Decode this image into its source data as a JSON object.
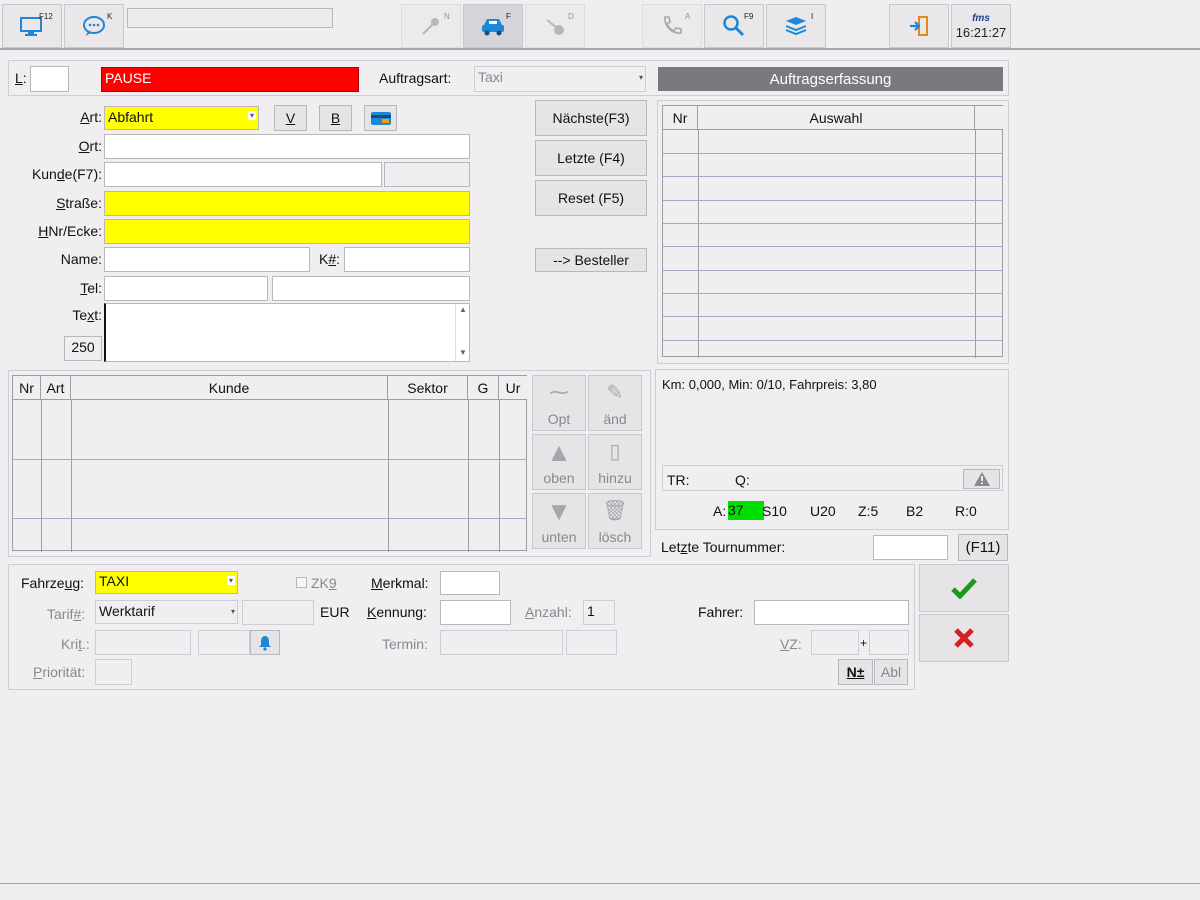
{
  "toolbar": {
    "btn_monitor": {
      "key": "F12"
    },
    "btn_chat": {
      "key": "K"
    },
    "btn_mic": {
      "key": "N"
    },
    "btn_car": {
      "key": "F"
    },
    "btn_tool": {
      "key": "D"
    },
    "btn_phone": {
      "key": "A"
    },
    "btn_search": {
      "key": "F9"
    },
    "btn_stack": {
      "key": "I"
    },
    "logo": "fms",
    "time": "16:21:27"
  },
  "header": {
    "l_label": "L",
    "pause_text": "PAUSE",
    "auftragsart_label": "Auftragsart:",
    "auftragsart_value": "Taxi",
    "title": "Auftragserfassung"
  },
  "form": {
    "art_label": "Art:",
    "art_value": "Abfahrt",
    "v_button": "V",
    "b_button": "B",
    "ort_label": "Ort:",
    "kunde_label": "Kunde(F7):",
    "strasse_label": "Straße:",
    "hnr_label": "HNr/Ecke:",
    "name_label": "Name:",
    "k_label": "K#:",
    "tel_label": "Tel:",
    "text_label": "Text:",
    "text_counter": "250"
  },
  "nav": {
    "next": "Nächste(F3)",
    "last": "Letzte (F4)",
    "reset": "Reset (F5)",
    "besteller": "--> Besteller"
  },
  "auswahl": {
    "columns": [
      "Nr",
      "Auswahl"
    ]
  },
  "route": {
    "columns": [
      "Nr",
      "Art",
      "Kunde",
      "Sektor",
      "G",
      "Ur"
    ]
  },
  "side_buttons": {
    "opt": "Opt",
    "aend": "änd",
    "oben": "oben",
    "hinzu": "hinzu",
    "unten": "unten",
    "loesch": "lösch"
  },
  "info": {
    "summary": "Km: 0,000, Min: 0/10, Fahrpreis: 3,80",
    "tr_label": "TR:",
    "q_label": "Q:",
    "a_label": "A:",
    "a_value": "37",
    "s": "S10",
    "u": "U20",
    "z": "Z:5",
    "b": "B2",
    "r": "R:0",
    "tour_label": "Letzte Tournummer:",
    "f11": "(F11)"
  },
  "vehicle": {
    "fahrzeug_label": "Fahrzeug:",
    "fahrzeug_value": "TAXI",
    "zk9": "ZK9",
    "merkmal_label": "Merkmal:",
    "tarif_label": "Tarif#:",
    "tarif_value": "Werktarif",
    "eur": "EUR",
    "kennung_label": "Kennung:",
    "anzahl_label": "Anzahl:",
    "anzahl_value": "1",
    "fahrer_label": "Fahrer:",
    "krit_label": "Krit.:",
    "termin_label": "Termin:",
    "vz_label": "VZ:",
    "plus": "+",
    "prioritaet_label": "Priorität:",
    "n_plus": "N±",
    "abl": "Abl"
  },
  "colors": {
    "pause": "#ff0000",
    "highlight": "#ffff00",
    "a_badge": "#00e000",
    "title_bar": "#7b797d",
    "ok": "#1a9a1a",
    "cancel": "#d42020"
  }
}
